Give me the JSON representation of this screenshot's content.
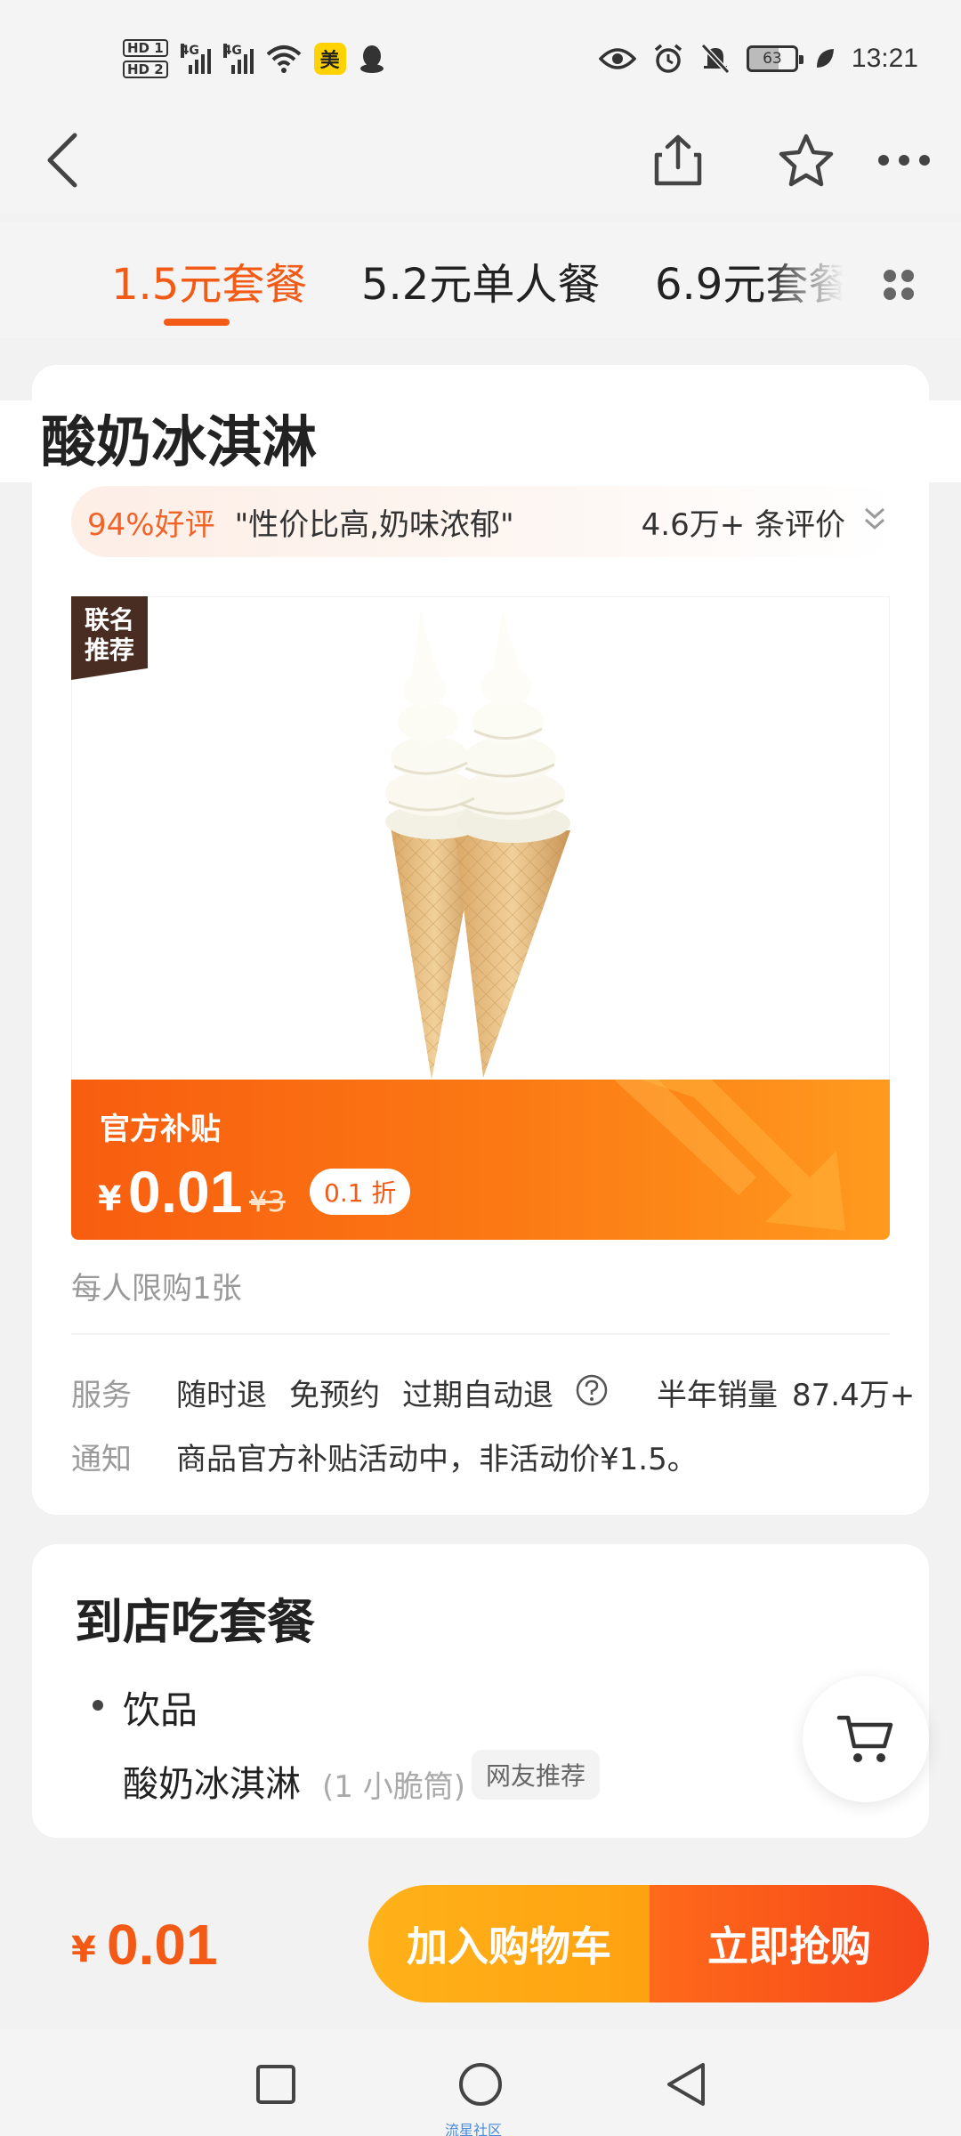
{
  "status_bar": {
    "hd1": "HD 1",
    "hd2": "HD 2",
    "network1": "4G",
    "network2": "4G",
    "app_badge": "美",
    "battery": "63",
    "time": "13:21"
  },
  "tabs": [
    {
      "label": "1.5元套餐",
      "active": true
    },
    {
      "label": "5.2元单人餐",
      "active": false
    },
    {
      "label": "6.9元套餐",
      "active": false
    }
  ],
  "product": {
    "title": "酸奶冰淇淋",
    "review_rate": "94%好评",
    "review_quote": "\"性价比高,奶味浓郁\"",
    "review_count": "4.6万+ 条评价",
    "badge": "联名推荐",
    "badge_line1": "联名",
    "badge_line2": "推荐"
  },
  "promo": {
    "label": "官方补贴",
    "currency": "¥",
    "price": "0.01",
    "original": "¥3",
    "discount": "0.1 折"
  },
  "limit": "每人限购1张",
  "service": {
    "label": "服务",
    "items": [
      "随时退",
      "免预约",
      "过期自动退"
    ],
    "sales_label": "半年销量",
    "sales_value": "87.4万+"
  },
  "notice": {
    "label": "通知",
    "text": "商品官方补贴活动中，非活动价¥1.5。"
  },
  "package": {
    "title": "到店吃套餐",
    "category": "饮品",
    "item_name": "酸奶冰淇淋",
    "item_size": "(1 小脆筒)",
    "item_tag": "网友推荐"
  },
  "bottom_bar": {
    "currency": "¥",
    "price": "0.01",
    "add_to_cart": "加入购物车",
    "buy_now": "立即抢购"
  },
  "watermark": "流星社区",
  "colors": {
    "accent": "#f25a16",
    "promo_start": "#f85d0f",
    "promo_end": "#ff9a1e",
    "cart_button": "#ffa110",
    "buy_button": "#f5461b",
    "badge_brown": "#4a2d22"
  },
  "icons": [
    "back-icon",
    "share-icon",
    "favorite-star-icon",
    "more-icon",
    "grid-menu-icon",
    "help-icon",
    "chevron-down-icon",
    "shopping-cart-icon",
    "recent-apps-icon",
    "home-icon",
    "back-triangle-icon"
  ]
}
